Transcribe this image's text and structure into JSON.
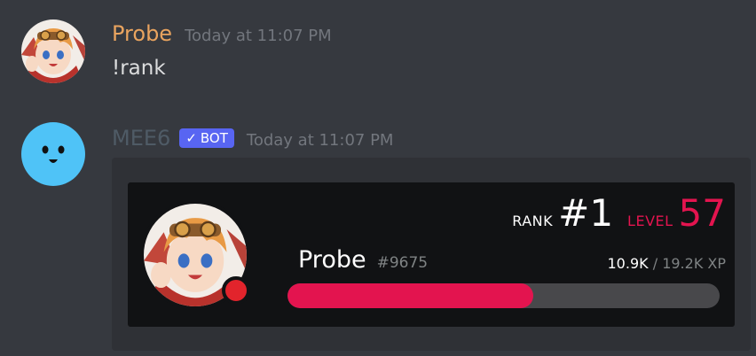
{
  "messages": [
    {
      "username": "Probe",
      "timestamp": "Today at 11:07 PM",
      "content": "!rank",
      "name_color": "#e9a45f"
    },
    {
      "username": "MEE6",
      "badge": "BOT",
      "timestamp": "Today at 11:07 PM",
      "name_color": "#4f5b66"
    }
  ],
  "rank_card": {
    "rank_label": "RANK",
    "rank_value": "#1",
    "level_label": "LEVEL",
    "level_value": "57",
    "username": "Probe",
    "discriminator": "#9675",
    "xp_current": "10.9K",
    "xp_rest": " / 19.2K XP",
    "progress_fraction": 0.568,
    "status": "do-not-disturb",
    "accent_color": "#e3144f"
  }
}
